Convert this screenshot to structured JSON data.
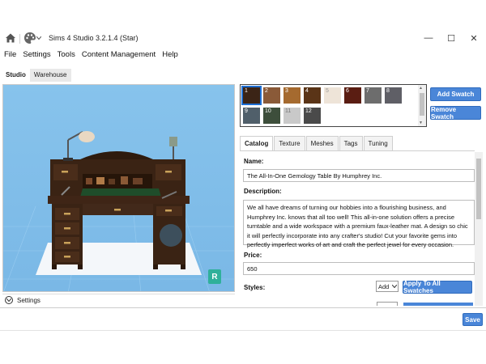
{
  "window": {
    "title": "Sims 4 Studio 3.2.1.4 (Star)",
    "minimize": "—",
    "maximize": "☐",
    "close": "✕"
  },
  "menu": [
    "File",
    "Settings",
    "Tools",
    "Content Management",
    "Help"
  ],
  "top_tabs": [
    {
      "label": "Studio",
      "active": true
    },
    {
      "label": "Warehouse",
      "active": false
    }
  ],
  "viewport": {
    "settings_label": "Settings",
    "watermark": "R"
  },
  "swatches": [
    {
      "num": "1",
      "color": "#3b2416",
      "selected": true
    },
    {
      "num": "2",
      "color": "#8a5a38"
    },
    {
      "num": "3",
      "color": "#a56a2f"
    },
    {
      "num": "4",
      "color": "#5a3417"
    },
    {
      "num": "5",
      "color": "#eee4d8"
    },
    {
      "num": "6",
      "color": "#5a1d12"
    },
    {
      "num": "7",
      "color": "#6d6d6d"
    },
    {
      "num": "8",
      "color": "#5f5f66"
    },
    {
      "num": "9",
      "color": "#505f6a"
    },
    {
      "num": "10",
      "color": "#3d4e3b"
    },
    {
      "num": "11",
      "color": "#c9c9c9"
    },
    {
      "num": "12",
      "color": "#4a4a4a"
    }
  ],
  "buttons": {
    "add_swatch": "Add Swatch",
    "remove_swatch": "Remove Swatch",
    "apply_all": "Apply To All Swatches",
    "add_select": "Add",
    "save": "Save"
  },
  "panel_tabs": [
    {
      "label": "Catalog",
      "active": true
    },
    {
      "label": "Texture"
    },
    {
      "label": "Meshes"
    },
    {
      "label": "Tags"
    },
    {
      "label": "Tuning"
    }
  ],
  "catalog": {
    "name_label": "Name:",
    "name_value": "The All-In-One Gemology Table By Humphrey Inc.",
    "description_label": "Description:",
    "description_value": "We all have dreams of turning our hobbies into a flourishing business, and Humphrey Inc. knows that all too well! This all-in-one solution offers a precise turntable and a wide workspace with a premium faux-leather mat. A design so chic it will perfectly incorporate into any crafter's studio! Cut your favorite gems into perfectly imperfect works of art and craft the perfect jewel for every occasion.",
    "price_label": "Price:",
    "price_value": "650",
    "styles_label": "Styles:"
  }
}
